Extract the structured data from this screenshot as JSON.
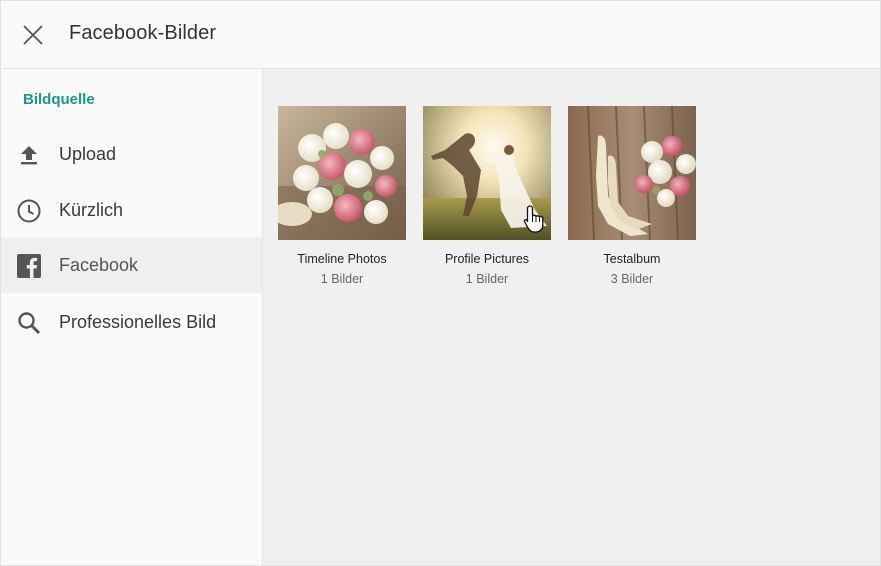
{
  "header": {
    "title": "Facebook-Bilder"
  },
  "sidebar": {
    "heading": "Bildquelle",
    "items": [
      {
        "label": "Upload",
        "icon": "upload-icon"
      },
      {
        "label": "Kürzlich",
        "icon": "clock-icon"
      },
      {
        "label": "Facebook",
        "icon": "facebook-icon",
        "active": true
      },
      {
        "label": "Professionelles Bild",
        "icon": "search-icon"
      }
    ]
  },
  "albums": [
    {
      "name": "Timeline Photos",
      "count": "1 Bilder"
    },
    {
      "name": "Profile Pictures",
      "count": "1 Bilder"
    },
    {
      "name": "Testalbum",
      "count": "3 Bilder"
    }
  ],
  "colors": {
    "accent": "#1a9a84",
    "active_bg": "#efefef"
  }
}
